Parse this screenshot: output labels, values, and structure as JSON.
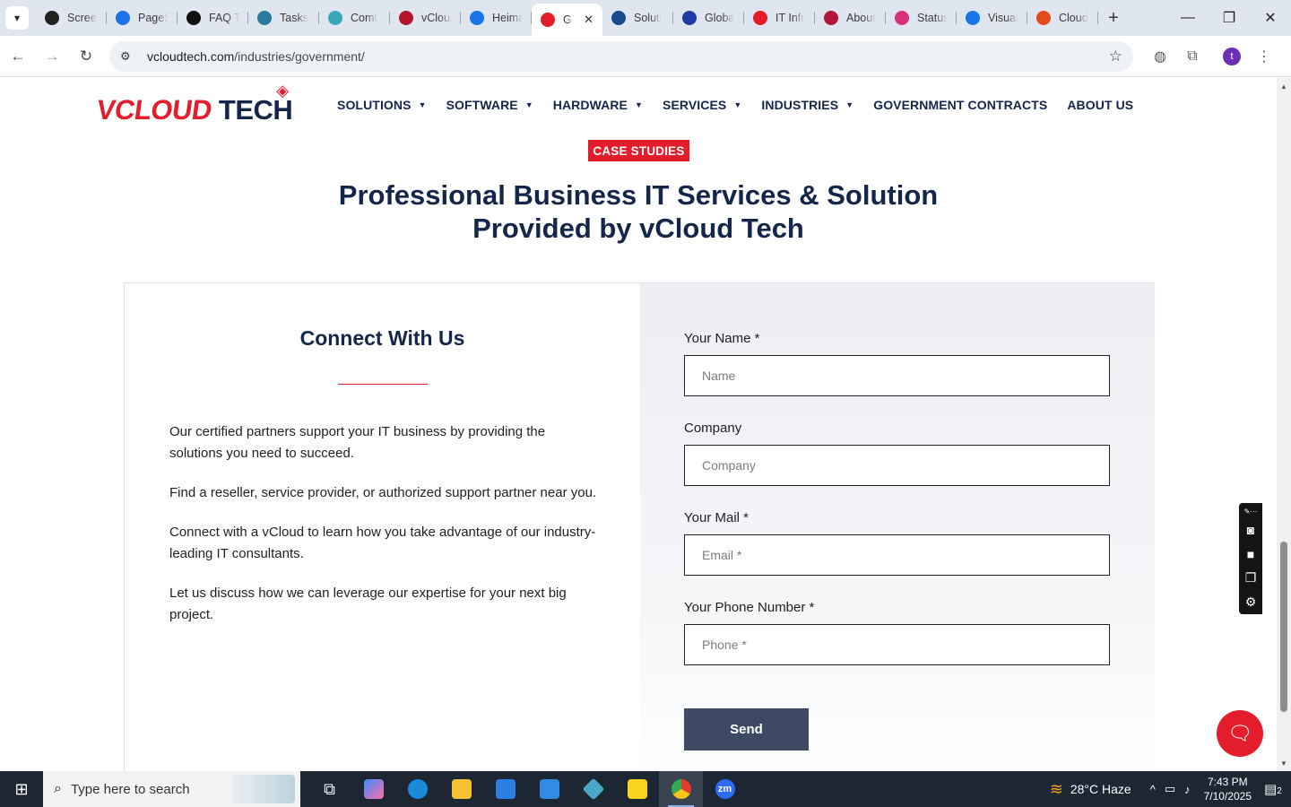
{
  "browser": {
    "tabs": [
      {
        "title": "Screen",
        "favicon": "gear-favicon",
        "color": "#222222"
      },
      {
        "title": "PageSpeed",
        "favicon": "pagespeed-favicon",
        "color": "#1a73e8"
      },
      {
        "title": "FAQ T",
        "favicon": "openai-favicon",
        "color": "#111111"
      },
      {
        "title": "Tasks",
        "favicon": "tasks-favicon",
        "color": "#2b7a9b"
      },
      {
        "title": "Comt",
        "favicon": "comt-favicon",
        "color": "#3aa7b8"
      },
      {
        "title": "vCloud",
        "favicon": "vcloud-favicon",
        "color": "#b3162b"
      },
      {
        "title": "Heima",
        "favicon": "scales-favicon",
        "color": "#1a73e8"
      },
      {
        "title": "G",
        "favicon": "vcloudtech-tag-favicon",
        "color": "#e31d2b",
        "active": true
      },
      {
        "title": "Soluti",
        "favicon": "check-favicon",
        "color": "#1a4a8c"
      },
      {
        "title": "Globa",
        "favicon": "x-favicon",
        "color": "#203aa6"
      },
      {
        "title": "IT Infr",
        "favicon": "tag-favicon",
        "color": "#e31d2b"
      },
      {
        "title": "About",
        "favicon": "aboutus-favicon",
        "color": "#b3163a"
      },
      {
        "title": "Status",
        "favicon": "status-favicon",
        "color": "#d6317a"
      },
      {
        "title": "Visual",
        "favicon": "pulse-favicon",
        "color": "#1a73e8"
      },
      {
        "title": "Cloud",
        "favicon": "cloud-favicon",
        "color": "#e34a1d"
      }
    ],
    "new_tab_label": "+",
    "url_host": "vcloudtech.com",
    "url_path": "/industries/government/",
    "profile_initial": "t",
    "window_controls": {
      "minimize": "—",
      "restore": "❐",
      "close": "✕"
    }
  },
  "site": {
    "logo_v": "VCLOUD",
    "logo_t": "TECH",
    "nav": [
      {
        "label": "SOLUTIONS",
        "dropdown": true
      },
      {
        "label": "SOFTWARE",
        "dropdown": true
      },
      {
        "label": "HARDWARE",
        "dropdown": true
      },
      {
        "label": "SERVICES",
        "dropdown": true
      },
      {
        "label": "INDUSTRIES",
        "dropdown": true
      },
      {
        "label": "GOVERNMENT CONTRACTS",
        "dropdown": false
      },
      {
        "label": "ABOUT US",
        "dropdown": false
      }
    ],
    "badge": "CASE STUDIES",
    "headline_line1": "Professional Business IT Services & Solution",
    "headline_line2": "Provided by vCloud Tech",
    "connect": {
      "title": "Connect With Us",
      "paragraphs": [
        "Our certified partners support your IT business by providing the solutions you need to succeed.",
        "Find a reseller, service provider, or authorized support partner near you.",
        "Connect with a vCloud to learn how you take advantage of our industry-leading IT consultants.",
        "Let us discuss how we can leverage our expertise for your next big project."
      ]
    },
    "form": {
      "name_label": "Your Name *",
      "name_placeholder": "Name",
      "company_label": "Company",
      "company_placeholder": "Company",
      "mail_label": "Your Mail *",
      "mail_placeholder": "Email *",
      "phone_label": "Your Phone Number *",
      "phone_placeholder": "Phone *",
      "send_label": "Send"
    }
  },
  "taskbar": {
    "search_placeholder": "Type here to search",
    "weather": "28°C  Haze",
    "time": "7:43 PM",
    "date": "7/10/2025",
    "notification_count": "2"
  },
  "colors": {
    "brand_red": "#e31d2b",
    "brand_navy": "#14264a",
    "send_button": "#3c4a63"
  }
}
